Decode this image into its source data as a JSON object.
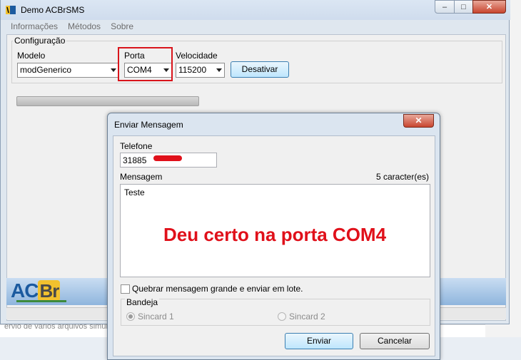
{
  "window": {
    "title": "Demo ACBrSMS",
    "controls": {
      "minimize": "–",
      "maximize": "□",
      "close": "✕"
    }
  },
  "menu": [
    "Informações",
    "Métodos",
    "Sobre"
  ],
  "config": {
    "legend": "Configuração",
    "modelo_label": "Modelo",
    "modelo_value": "modGenerico",
    "porta_label": "Porta",
    "porta_value": "COM4",
    "velocidade_label": "Velocidade",
    "velocidade_value": "115200",
    "desativar_button": "Desativar"
  },
  "logo": {
    "text_a": "AC",
    "text_b": "Br"
  },
  "background_text": "ervio de varios arquivos simult",
  "dialog": {
    "title": "Enviar Mensagem",
    "close": "✕",
    "telefone_label": "Telefone",
    "telefone_value": "31885",
    "mensagem_label": "Mensagem",
    "char_count": "5 caracter(es)",
    "mensagem_value": "Teste",
    "annotation": "Deu certo na porta COM4",
    "split_checkbox_label": "Quebrar mensagem grande e enviar em lote.",
    "bandeja_legend": "Bandeja",
    "sincard1_label": "Sincard 1",
    "sincard2_label": "Sincard 2",
    "enviar_button": "Enviar",
    "cancelar_button": "Cancelar"
  },
  "colors": {
    "highlight": "#d9141b",
    "annotation": "#e0101a"
  }
}
